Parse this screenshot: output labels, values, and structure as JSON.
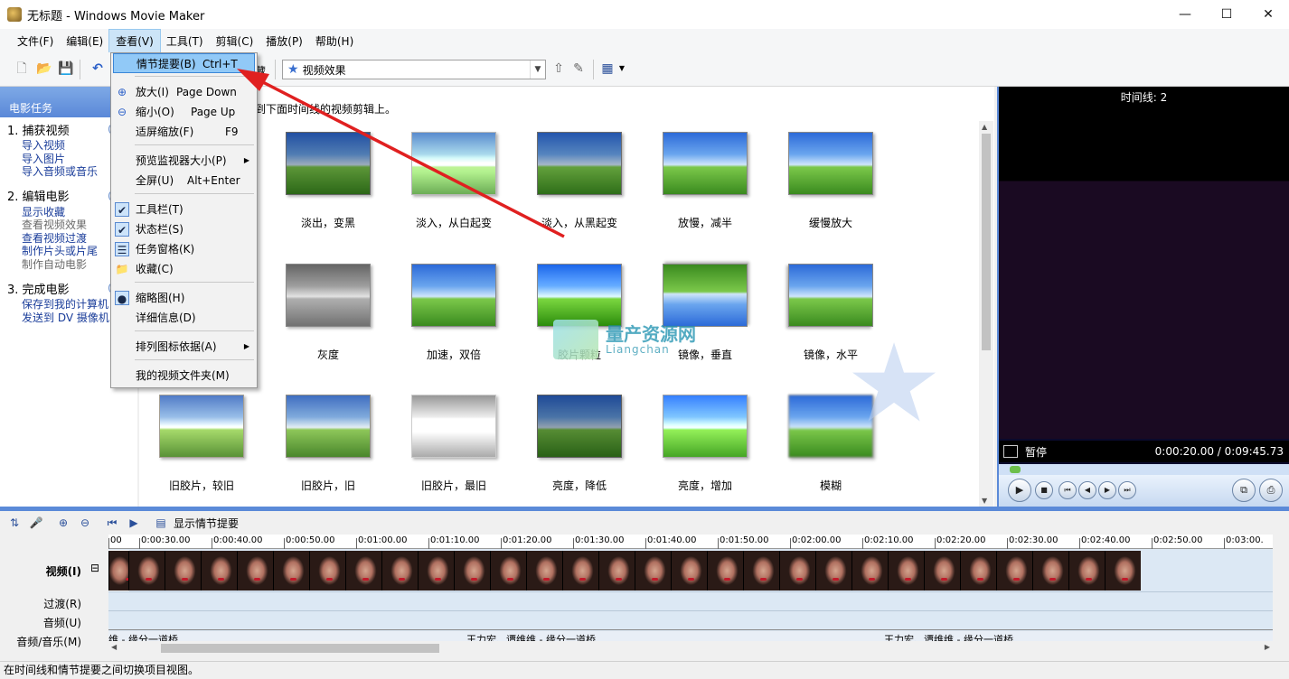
{
  "window": {
    "title": "无标题 - Windows Movie Maker",
    "min": "—",
    "max": "☐",
    "close": "✕"
  },
  "menubar": [
    {
      "label": "文件(F)"
    },
    {
      "label": "编辑(E)"
    },
    {
      "label": "查看(V)"
    },
    {
      "label": "工具(T)"
    },
    {
      "label": "剪辑(C)"
    },
    {
      "label": "播放(P)"
    },
    {
      "label": "帮助(H)"
    }
  ],
  "toolbar": {
    "collection_label": "藏",
    "collection_value": "视频效果"
  },
  "taskpane": {
    "header": "电影任务",
    "sections": [
      {
        "title": "1.  捕获视频",
        "links": [
          {
            "text": "导入视频"
          },
          {
            "text": "导入图片"
          },
          {
            "text": "导入音频或音乐"
          }
        ]
      },
      {
        "title": "2.  编辑电影",
        "links": [
          {
            "text": "显示收藏"
          },
          {
            "text": "查看视频效果",
            "dim": true
          },
          {
            "text": "查看视频过渡"
          },
          {
            "text": "制作片头或片尾"
          },
          {
            "text": "制作自动电影",
            "dim": true
          }
        ]
      },
      {
        "title": "3.  完成电影",
        "links": [
          {
            "text": "保存到我的计算机"
          },
          {
            "text": "发送到 DV 摄像机"
          }
        ]
      }
    ]
  },
  "content": {
    "instruction": "到下面时间线的视频剪辑上。",
    "effects": [
      {
        "label": "淡出，变黑"
      },
      {
        "label": "淡入，从白起变"
      },
      {
        "label": "淡入，从黑起变"
      },
      {
        "label": "放慢，减半"
      },
      {
        "label": "缓慢放大"
      },
      {
        "label": "灰度"
      },
      {
        "label": "加速，双倍"
      },
      {
        "label": "胶片颗粒"
      },
      {
        "label": "镜像，垂直"
      },
      {
        "label": "镜像，水平"
      },
      {
        "label": "旧胶片，较旧"
      },
      {
        "label": "旧胶片，旧"
      },
      {
        "label": "旧胶片，最旧"
      },
      {
        "label": "亮度，降低"
      },
      {
        "label": "亮度，增加"
      },
      {
        "label": "模糊"
      }
    ]
  },
  "watermark": {
    "cn": "量产资源网",
    "en": "Liangchan"
  },
  "monitor": {
    "title": "时间线: 2",
    "status": "暂停",
    "time": "0:00:20.00 / 0:09:45.73"
  },
  "timeline": {
    "toggle_label": "显示情节提要",
    "ruler": [
      "00",
      "0:00:30.00",
      "0:00:40.00",
      "0:00:50.00",
      "0:01:00.00",
      "0:01:10.00",
      "0:01:20.00",
      "0:01:30.00",
      "0:01:40.00",
      "0:01:50.00",
      "0:02:00.00",
      "0:02:10.00",
      "0:02:20.00",
      "0:02:30.00",
      "0:02:40.00",
      "0:02:50.00",
      "0:03:00."
    ],
    "tracks": {
      "video": "视频(I)",
      "video_toggle": "⊟",
      "transition": "过渡(R)",
      "audio": "音频(U)",
      "music": "音频/音乐(M)"
    },
    "music_clips": [
      "维 - 缘分一道桥",
      "王力宏、谭维维 - 缘分一道桥",
      "王力宏、谭维维 - 缘分一道桥"
    ]
  },
  "statusbar": "在时间线和情节提要之间切换项目视图。",
  "view_menu": [
    {
      "label": "情节提要(B)",
      "accel": "Ctrl+T",
      "highlight": true
    },
    {
      "label": "放大(I)",
      "accel": "Page Down",
      "icon": "zoom-in-icon"
    },
    {
      "label": "缩小(O)",
      "accel": "Page Up",
      "icon": "zoom-out-icon"
    },
    {
      "label": "适屏缩放(F)",
      "accel": "F9"
    },
    {
      "label": "预览监视器大小(P)",
      "submenu": true
    },
    {
      "label": "全屏(U)",
      "accel": "Alt+Enter"
    },
    {
      "label": "工具栏(T)",
      "checked": true
    },
    {
      "label": "状态栏(S)",
      "checked": true
    },
    {
      "label": "任务窗格(K)",
      "icon": "taskpane-icon"
    },
    {
      "label": "收藏(C)",
      "icon": "folder-icon"
    },
    {
      "label": "缩略图(H)",
      "radio": true
    },
    {
      "label": "详细信息(D)"
    },
    {
      "label": "排列图标依据(A)",
      "submenu": true
    },
    {
      "label": "我的视频文件夹(M)"
    }
  ],
  "colors": {
    "accent": "#5b8ad8",
    "arrow": "#e02020",
    "menu_highlight": "#91c9f7"
  }
}
